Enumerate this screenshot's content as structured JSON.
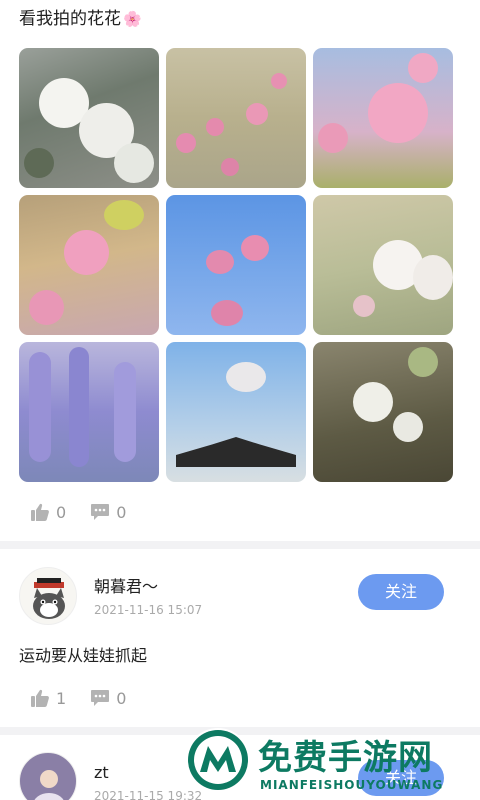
{
  "post1": {
    "title": "看我拍的花花",
    "title_emoji": "🌸",
    "photos": [
      {
        "label": "white-cherry-blossoms"
      },
      {
        "label": "pink-blossoms-branches"
      },
      {
        "label": "pink-double-cherry"
      },
      {
        "label": "pink-cherry-yellow-leaves"
      },
      {
        "label": "pink-cherry-blue-sky"
      },
      {
        "label": "white-double-cherry"
      },
      {
        "label": "purple-wisteria"
      },
      {
        "label": "pagoda-roof-blossoms"
      },
      {
        "label": "white-blossoms-dark"
      }
    ],
    "likes": "0",
    "comments": "0"
  },
  "post2": {
    "username": "朝暮君～",
    "timestamp": "2021-11-16 15:07",
    "follow_label": "关注",
    "text": "运动要从娃娃抓起",
    "likes": "1",
    "comments": "0"
  },
  "post3": {
    "username": "zt",
    "timestamp": "2021-11-15 19:32",
    "follow_label": "关注"
  },
  "watermark": {
    "title": "免费手游网",
    "subtitle": "MIANFEISHOUYOUWANG"
  },
  "colors": {
    "accent": "#6c9af0",
    "watermark": "#0d7a62",
    "divider": "#f2f2f4"
  }
}
